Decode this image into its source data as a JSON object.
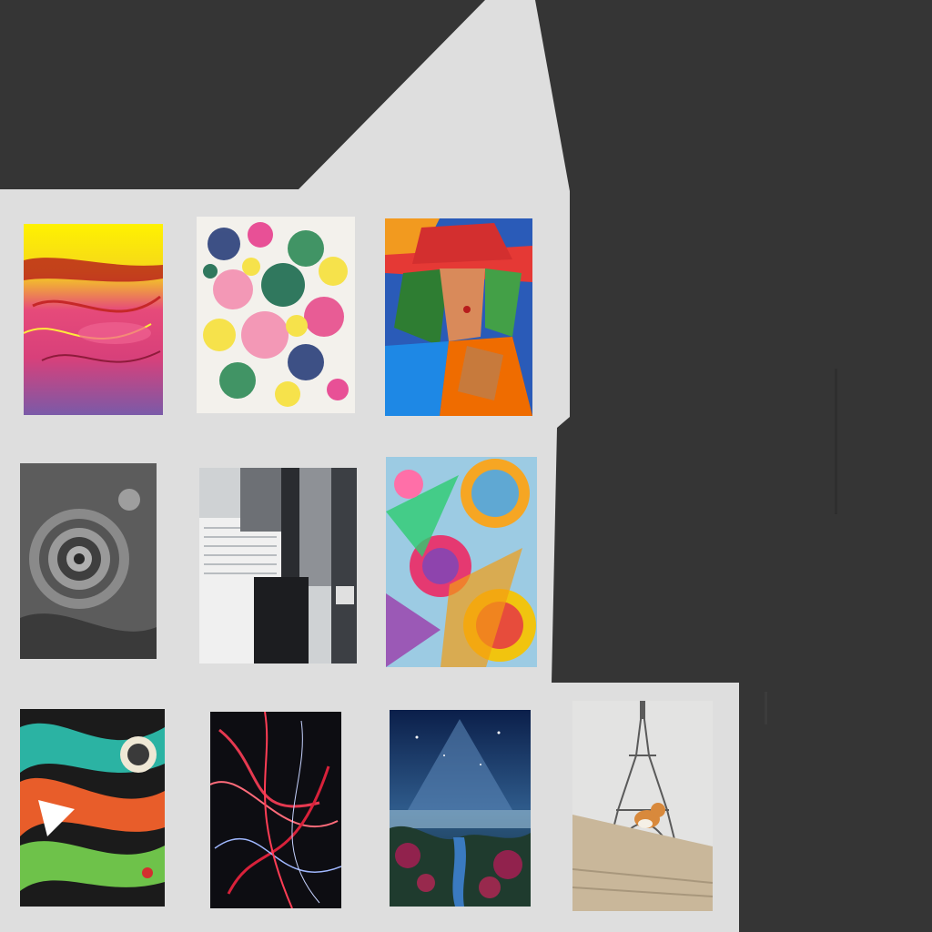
{
  "gallery": {
    "colors": {
      "backdrop": "#353535",
      "panel": "#dedede"
    },
    "tiles": [
      {
        "id": "t1",
        "icon": "abstract-pink-yellow-painting"
      },
      {
        "id": "t2",
        "icon": "splatter-painting"
      },
      {
        "id": "t3",
        "icon": "cubist-woman-hat-painting"
      },
      {
        "id": "t4",
        "icon": "grayscale-spiral-photo"
      },
      {
        "id": "t5",
        "icon": "skyscrapers-photo"
      },
      {
        "id": "t6",
        "icon": "geometric-circles-painting"
      },
      {
        "id": "t7",
        "icon": "graffiti-swirl-painting"
      },
      {
        "id": "t8",
        "icon": "red-light-trails-photo"
      },
      {
        "id": "t9",
        "icon": "night-sky-landscape-painting"
      },
      {
        "id": "t10",
        "icon": "eiffel-tower-cat-photo"
      }
    ]
  }
}
